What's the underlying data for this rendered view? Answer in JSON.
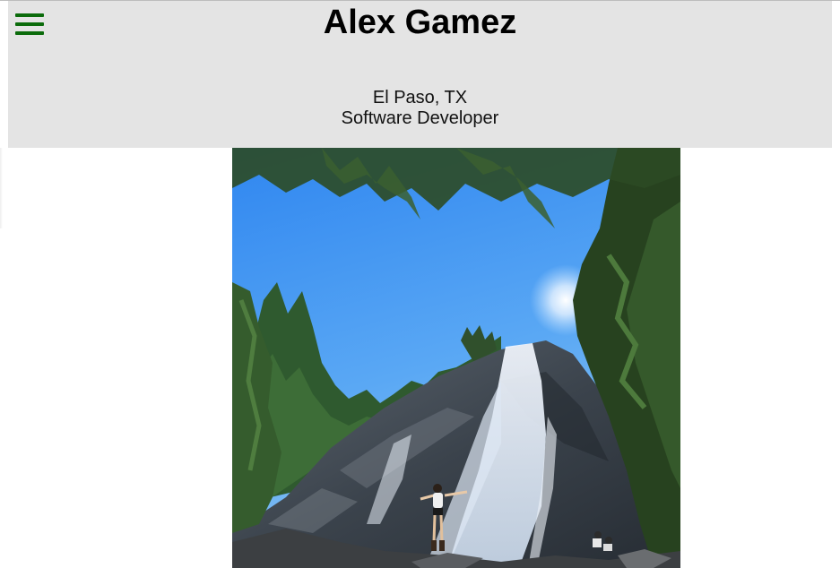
{
  "header": {
    "name": "Alex Gamez",
    "location": "El Paso, TX",
    "role": "Software Developer",
    "menu_icon": "hamburger-menu-icon",
    "background_color": "#e4e4e4",
    "menu_icon_color": "#0b6b0b"
  },
  "photo": {
    "subject": "waterfall-hiking-photo"
  }
}
